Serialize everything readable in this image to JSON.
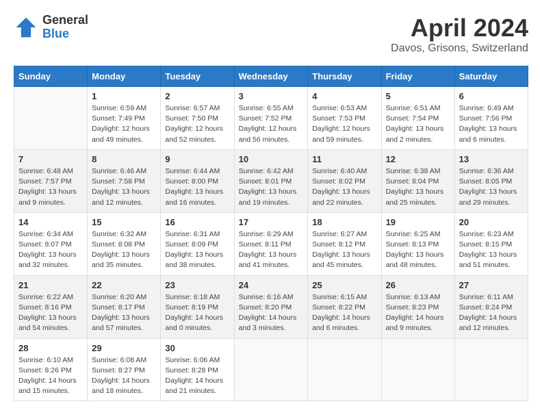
{
  "logo": {
    "general": "General",
    "blue": "Blue"
  },
  "title": "April 2024",
  "location": "Davos, Grisons, Switzerland",
  "weekdays": [
    "Sunday",
    "Monday",
    "Tuesday",
    "Wednesday",
    "Thursday",
    "Friday",
    "Saturday"
  ],
  "weeks": [
    [
      {
        "day": "",
        "sunrise": "",
        "sunset": "",
        "daylight": ""
      },
      {
        "day": "1",
        "sunrise": "Sunrise: 6:59 AM",
        "sunset": "Sunset: 7:49 PM",
        "daylight": "Daylight: 12 hours and 49 minutes."
      },
      {
        "day": "2",
        "sunrise": "Sunrise: 6:57 AM",
        "sunset": "Sunset: 7:50 PM",
        "daylight": "Daylight: 12 hours and 52 minutes."
      },
      {
        "day": "3",
        "sunrise": "Sunrise: 6:55 AM",
        "sunset": "Sunset: 7:52 PM",
        "daylight": "Daylight: 12 hours and 56 minutes."
      },
      {
        "day": "4",
        "sunrise": "Sunrise: 6:53 AM",
        "sunset": "Sunset: 7:53 PM",
        "daylight": "Daylight: 12 hours and 59 minutes."
      },
      {
        "day": "5",
        "sunrise": "Sunrise: 6:51 AM",
        "sunset": "Sunset: 7:54 PM",
        "daylight": "Daylight: 13 hours and 2 minutes."
      },
      {
        "day": "6",
        "sunrise": "Sunrise: 6:49 AM",
        "sunset": "Sunset: 7:56 PM",
        "daylight": "Daylight: 13 hours and 6 minutes."
      }
    ],
    [
      {
        "day": "7",
        "sunrise": "Sunrise: 6:48 AM",
        "sunset": "Sunset: 7:57 PM",
        "daylight": "Daylight: 13 hours and 9 minutes."
      },
      {
        "day": "8",
        "sunrise": "Sunrise: 6:46 AM",
        "sunset": "Sunset: 7:58 PM",
        "daylight": "Daylight: 13 hours and 12 minutes."
      },
      {
        "day": "9",
        "sunrise": "Sunrise: 6:44 AM",
        "sunset": "Sunset: 8:00 PM",
        "daylight": "Daylight: 13 hours and 16 minutes."
      },
      {
        "day": "10",
        "sunrise": "Sunrise: 6:42 AM",
        "sunset": "Sunset: 8:01 PM",
        "daylight": "Daylight: 13 hours and 19 minutes."
      },
      {
        "day": "11",
        "sunrise": "Sunrise: 6:40 AM",
        "sunset": "Sunset: 8:02 PM",
        "daylight": "Daylight: 13 hours and 22 minutes."
      },
      {
        "day": "12",
        "sunrise": "Sunrise: 6:38 AM",
        "sunset": "Sunset: 8:04 PM",
        "daylight": "Daylight: 13 hours and 25 minutes."
      },
      {
        "day": "13",
        "sunrise": "Sunrise: 6:36 AM",
        "sunset": "Sunset: 8:05 PM",
        "daylight": "Daylight: 13 hours and 29 minutes."
      }
    ],
    [
      {
        "day": "14",
        "sunrise": "Sunrise: 6:34 AM",
        "sunset": "Sunset: 8:07 PM",
        "daylight": "Daylight: 13 hours and 32 minutes."
      },
      {
        "day": "15",
        "sunrise": "Sunrise: 6:32 AM",
        "sunset": "Sunset: 8:08 PM",
        "daylight": "Daylight: 13 hours and 35 minutes."
      },
      {
        "day": "16",
        "sunrise": "Sunrise: 6:31 AM",
        "sunset": "Sunset: 8:09 PM",
        "daylight": "Daylight: 13 hours and 38 minutes."
      },
      {
        "day": "17",
        "sunrise": "Sunrise: 6:29 AM",
        "sunset": "Sunset: 8:11 PM",
        "daylight": "Daylight: 13 hours and 41 minutes."
      },
      {
        "day": "18",
        "sunrise": "Sunrise: 6:27 AM",
        "sunset": "Sunset: 8:12 PM",
        "daylight": "Daylight: 13 hours and 45 minutes."
      },
      {
        "day": "19",
        "sunrise": "Sunrise: 6:25 AM",
        "sunset": "Sunset: 8:13 PM",
        "daylight": "Daylight: 13 hours and 48 minutes."
      },
      {
        "day": "20",
        "sunrise": "Sunrise: 6:23 AM",
        "sunset": "Sunset: 8:15 PM",
        "daylight": "Daylight: 13 hours and 51 minutes."
      }
    ],
    [
      {
        "day": "21",
        "sunrise": "Sunrise: 6:22 AM",
        "sunset": "Sunset: 8:16 PM",
        "daylight": "Daylight: 13 hours and 54 minutes."
      },
      {
        "day": "22",
        "sunrise": "Sunrise: 6:20 AM",
        "sunset": "Sunset: 8:17 PM",
        "daylight": "Daylight: 13 hours and 57 minutes."
      },
      {
        "day": "23",
        "sunrise": "Sunrise: 6:18 AM",
        "sunset": "Sunset: 8:19 PM",
        "daylight": "Daylight: 14 hours and 0 minutes."
      },
      {
        "day": "24",
        "sunrise": "Sunrise: 6:16 AM",
        "sunset": "Sunset: 8:20 PM",
        "daylight": "Daylight: 14 hours and 3 minutes."
      },
      {
        "day": "25",
        "sunrise": "Sunrise: 6:15 AM",
        "sunset": "Sunset: 8:22 PM",
        "daylight": "Daylight: 14 hours and 6 minutes."
      },
      {
        "day": "26",
        "sunrise": "Sunrise: 6:13 AM",
        "sunset": "Sunset: 8:23 PM",
        "daylight": "Daylight: 14 hours and 9 minutes."
      },
      {
        "day": "27",
        "sunrise": "Sunrise: 6:11 AM",
        "sunset": "Sunset: 8:24 PM",
        "daylight": "Daylight: 14 hours and 12 minutes."
      }
    ],
    [
      {
        "day": "28",
        "sunrise": "Sunrise: 6:10 AM",
        "sunset": "Sunset: 8:26 PM",
        "daylight": "Daylight: 14 hours and 15 minutes."
      },
      {
        "day": "29",
        "sunrise": "Sunrise: 6:08 AM",
        "sunset": "Sunset: 8:27 PM",
        "daylight": "Daylight: 14 hours and 18 minutes."
      },
      {
        "day": "30",
        "sunrise": "Sunrise: 6:06 AM",
        "sunset": "Sunset: 8:28 PM",
        "daylight": "Daylight: 14 hours and 21 minutes."
      },
      {
        "day": "",
        "sunrise": "",
        "sunset": "",
        "daylight": ""
      },
      {
        "day": "",
        "sunrise": "",
        "sunset": "",
        "daylight": ""
      },
      {
        "day": "",
        "sunrise": "",
        "sunset": "",
        "daylight": ""
      },
      {
        "day": "",
        "sunrise": "",
        "sunset": "",
        "daylight": ""
      }
    ]
  ]
}
